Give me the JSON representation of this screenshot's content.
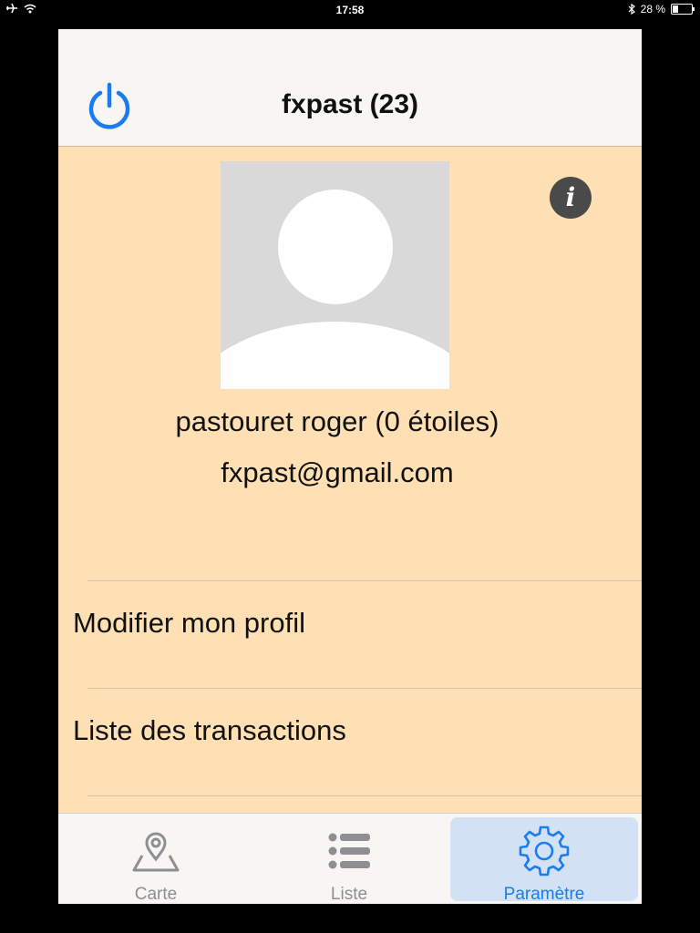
{
  "status_bar": {
    "time": "17:58",
    "battery": "28 %",
    "battery_level": 0.28
  },
  "header": {
    "title": "fxpast (23)",
    "power_icon": "power-icon",
    "accent_color": "#1a7cf0"
  },
  "profile": {
    "name_line": "pastouret roger (0 étoiles)",
    "email": "fxpast@gmail.com",
    "info_icon": "info-icon",
    "info_glyph": "i"
  },
  "menu": {
    "items": [
      {
        "label": "Modifier mon profil"
      },
      {
        "label": "Liste des transactions"
      }
    ]
  },
  "tabs": [
    {
      "label": "Carte",
      "icon": "map-pin-icon",
      "active": false
    },
    {
      "label": "Liste",
      "icon": "list-icon",
      "active": false
    },
    {
      "label": "Paramètre",
      "icon": "gear-icon",
      "active": true
    }
  ],
  "colors": {
    "background": "#fee0b4",
    "nav_background": "#f7f6f3",
    "active_tab": "#1a7cf0",
    "inactive_tab": "#8e8e93"
  }
}
